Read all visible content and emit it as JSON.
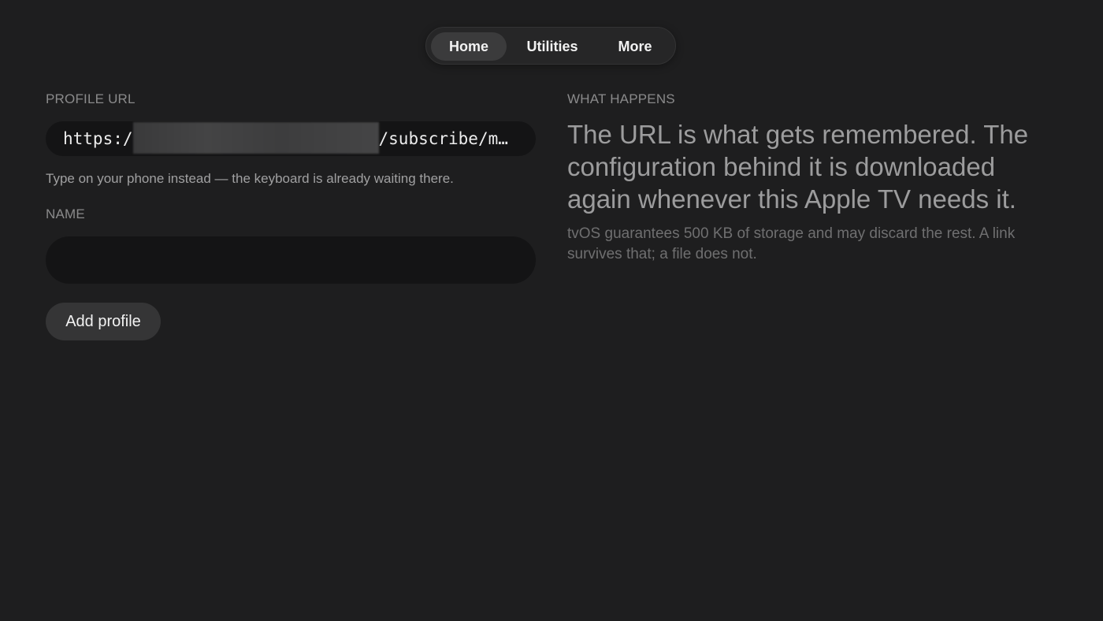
{
  "nav": {
    "tabs": [
      {
        "label": "Home",
        "active": true
      },
      {
        "label": "Utilities",
        "active": false
      },
      {
        "label": "More",
        "active": false
      }
    ]
  },
  "form": {
    "profile_url_label": "PROFILE URL",
    "profile_url_prefix": "https:/",
    "profile_url_suffix": "/subscribe/m…",
    "hint": "Type on your phone instead — the keyboard is already waiting there.",
    "name_label": "NAME",
    "name_value": "",
    "add_button_label": "Add profile"
  },
  "info": {
    "label": "WHAT HAPPENS",
    "headline": "The URL is what gets remembered. The configuration behind it is downloaded again whenever this Apple TV needs it.",
    "body": "tvOS guarantees 500 KB of storage and may discard the rest. A link survives that; a file does not."
  },
  "colors": {
    "background": "#1e1e1f",
    "field_background": "#141415",
    "button_background": "#353536"
  }
}
